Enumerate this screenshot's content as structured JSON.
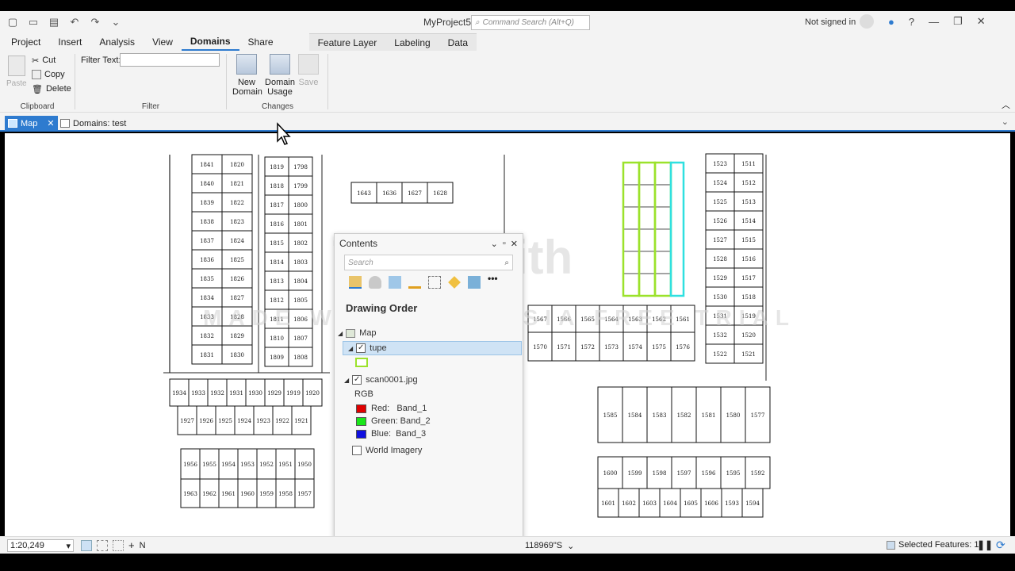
{
  "app": {
    "title": "MyProject5",
    "command_search_placeholder": "Command Search (Alt+Q)",
    "signin_text": "Not signed in"
  },
  "ribbon_tabs": [
    "Project",
    "Insert",
    "Analysis",
    "View",
    "Domains",
    "Share"
  ],
  "active_tab": "Domains",
  "contextual_tabs": [
    "Feature Layer",
    "Labeling",
    "Data"
  ],
  "clipboard": {
    "paste_label": "Paste",
    "cut_label": "Cut",
    "copy_label": "Copy",
    "delete_label": "Delete",
    "group_label": "Clipboard"
  },
  "filter": {
    "label": "Filter Text:",
    "value": "",
    "group_label": "Filter"
  },
  "changes": {
    "new_domain_label_1": "New",
    "new_domain_label_2": "Domain",
    "domain_usage_label_1": "Domain",
    "domain_usage_label_2": "Usage",
    "save_label": "Save",
    "group_label": "Changes"
  },
  "doc_tabs": {
    "map_label": "Map",
    "domains_label": "Domains: test"
  },
  "contents": {
    "title": "Contents",
    "search_placeholder": "Search",
    "drawing_order_label": "Drawing Order",
    "map_label": "Map",
    "layer1_name": "tupe",
    "layer2_name": "scan0001.jpg",
    "rgb_label": "RGB",
    "band_red": "Red:   Band_1",
    "band_green": "Green: Band_2",
    "band_blue": "Blue:  Band_3",
    "world_imagery": "World Imagery"
  },
  "status": {
    "scale": "1:20,249",
    "coordinates": "118969\"S",
    "selected_features": "Selected Features: 1"
  },
  "watermark": {
    "brand": "TechSmith",
    "text": "MADE WITH CAMTASIA FREE TRIAL"
  },
  "colors": {
    "accent": "#2e7bcf",
    "selection_green": "#9be22b",
    "selection_cyan": "#2fe0e0",
    "red": "#e00000",
    "green": "#19e619",
    "blue": "#1010e0"
  },
  "plan_lot_numbers": {
    "col_a": [
      "1841",
      "1840",
      "1839",
      "1838",
      "1837",
      "1836",
      "1835",
      "1834",
      "1833",
      "1832",
      "1831"
    ],
    "col_b": [
      "1820",
      "1821",
      "1822",
      "1823",
      "1824",
      "1825",
      "1826",
      "1827",
      "1828",
      "1829",
      "1830"
    ],
    "col_c": [
      "1819",
      "1818",
      "1817",
      "1816",
      "1815",
      "1814",
      "1813",
      "1812",
      "1811",
      "1810",
      "1809"
    ],
    "col_d": [
      "1798",
      "1799",
      "1800",
      "1801",
      "1802",
      "1803",
      "1804",
      "1805",
      "1806",
      "1807",
      "1808"
    ],
    "col_e": [
      "1523",
      "1524",
      "1525",
      "1526",
      "1527",
      "1528",
      "1529",
      "1530",
      "1531",
      "1532",
      "1522"
    ],
    "col_f": [
      "1511",
      "1512",
      "1513",
      "1514",
      "1515",
      "1516",
      "1517",
      "1518",
      "1519",
      "1520",
      "1521"
    ],
    "row_g": [
      "1567",
      "1566",
      "1565",
      "1564",
      "1563",
      "1562",
      "1561"
    ],
    "row_h": [
      "1570",
      "1571",
      "1572",
      "1573",
      "1574",
      "1575",
      "1576"
    ],
    "row_i": [
      "1585",
      "1584",
      "1583",
      "1582",
      "1581",
      "1580",
      "1577"
    ],
    "row_j": [
      "1600",
      "1599",
      "1598",
      "1597",
      "1596",
      "1595",
      "1592"
    ],
    "row_k": [
      "1601",
      "1602",
      "1603",
      "1604",
      "1605",
      "1606",
      "1593",
      "1594"
    ],
    "row_l": [
      "1934",
      "1933",
      "1932",
      "1931",
      "1930",
      "1929",
      "1919",
      "1920"
    ],
    "row_m": [
      "1927",
      "1926",
      "1925",
      "1924",
      "1923",
      "1922",
      "1921"
    ],
    "row_n": [
      "1956",
      "1955",
      "1954",
      "1953",
      "1952",
      "1951",
      "1950"
    ],
    "row_o": [
      "1963",
      "1962",
      "1961",
      "1960",
      "1959",
      "1958",
      "1957"
    ]
  }
}
